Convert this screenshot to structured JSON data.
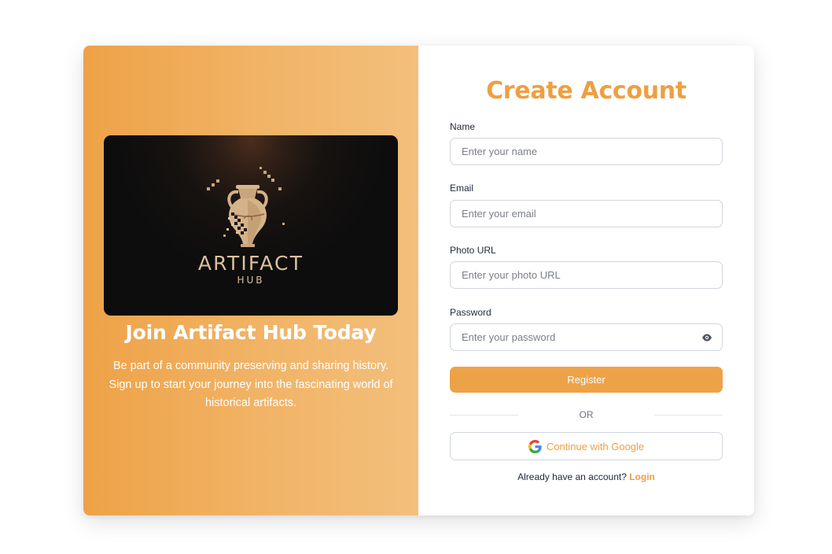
{
  "colors": {
    "accent": "#eea247",
    "accent_text": "#ee9f43",
    "hero_bg": "#0d0d0d",
    "brand_gold": "#dcc19b"
  },
  "left_panel": {
    "hero": {
      "brand_title": "ARTIFACT",
      "brand_subtitle": "HUB",
      "icon": "amphora-vase-icon"
    },
    "heading": "Join Artifact Hub Today",
    "description": "Be part of a community preserving and sharing history. Sign up to start your journey into the fascinating world of historical artifacts."
  },
  "form": {
    "title": "Create Account",
    "fields": {
      "name": {
        "label": "Name",
        "placeholder": "Enter your name",
        "value": ""
      },
      "email": {
        "label": "Email",
        "placeholder": "Enter your email",
        "value": ""
      },
      "photo_url": {
        "label": "Photo URL",
        "placeholder": "Enter your photo URL",
        "value": ""
      },
      "password": {
        "label": "Password",
        "placeholder": "Enter your password",
        "value": "",
        "toggle_icon": "eye-icon"
      }
    },
    "register_label": "Register",
    "or_label": "OR",
    "google_label": "Continue with Google",
    "google_icon": "google-icon",
    "footer_text": "Already have an account?",
    "login_link": "Login"
  }
}
